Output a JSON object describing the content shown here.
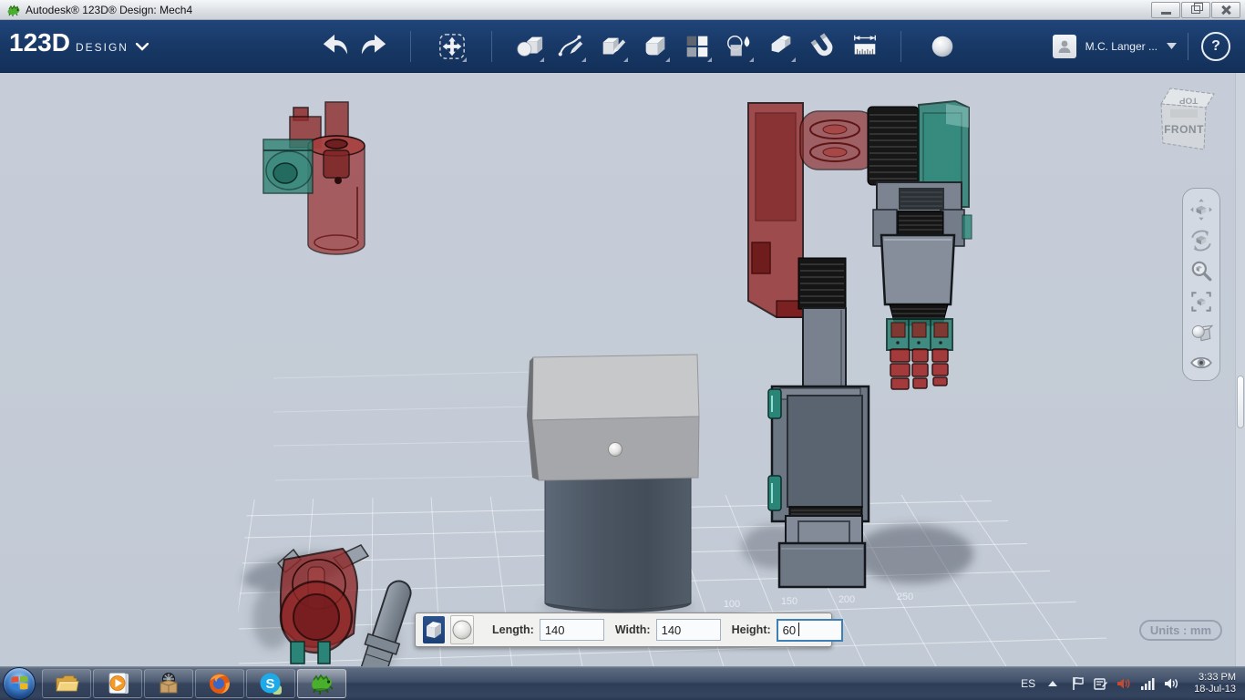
{
  "titlebar": {
    "title": "Autodesk® 123D® Design: Mech4"
  },
  "navbar": {
    "brand": "123D",
    "brand_sub": "DESIGN",
    "tool_names": [
      "undo",
      "redo",
      "transform",
      "primitives",
      "sketch",
      "construct",
      "modify",
      "pattern",
      "combine",
      "grouping",
      "snap",
      "measure",
      "material"
    ],
    "user_name": "M.C. Langer ...",
    "help_glyph": "?"
  },
  "viewport": {
    "viewcube_front": "FRONT",
    "viewcube_top": "TOP",
    "grid_labels": [
      "100",
      "150",
      "200",
      "250"
    ],
    "units_label": "Units : mm",
    "nav_tool_names": [
      "pan",
      "orbit",
      "zoom-view",
      "fit-view",
      "shading",
      "visibility"
    ]
  },
  "primitive_dialog": {
    "shape_options": [
      "box",
      "sphere"
    ],
    "length_label": "Length:",
    "length_value": "140",
    "width_label": "Width:",
    "width_value": "140",
    "height_label": "Height:",
    "height_value": "60"
  },
  "taskbar": {
    "app_names": [
      "start",
      "windows-explorer",
      "media-player",
      "box-app",
      "firefox",
      "skype",
      "123d-design"
    ],
    "tray_language": "ES",
    "tray_time": "3:33 PM",
    "tray_date": "18-Jul-13"
  }
}
